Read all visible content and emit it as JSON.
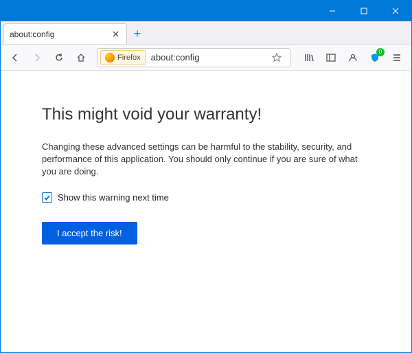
{
  "window": {
    "minimize": "—",
    "maximize": "□",
    "close": "✕"
  },
  "tab": {
    "title": "about:config",
    "close": "✕",
    "newtab": "+"
  },
  "toolbar": {
    "identity_label": "Firefox",
    "url": "about:config",
    "pocket_badge": "0"
  },
  "page": {
    "heading": "This might void your warranty!",
    "body": "Changing these advanced settings can be harmful to the stability, security, and performance of this application. You should only continue if you are sure of what you are doing.",
    "checkbox_label": "Show this warning next time",
    "accept_label": "I accept the risk!"
  }
}
